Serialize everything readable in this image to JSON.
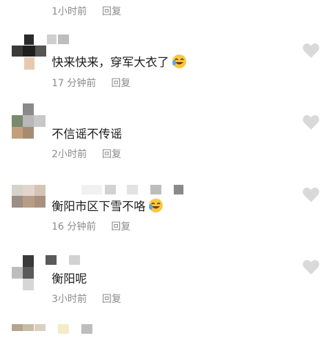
{
  "comments": [
    {
      "text": "",
      "time": "1小时前",
      "reply": "回复",
      "emoji": false
    },
    {
      "text": "快来快来，穿军大衣了",
      "time": "17 分钟前",
      "reply": "回复",
      "emoji": true
    },
    {
      "text": "不信谣不传谣",
      "time": "2小时前",
      "reply": "回复",
      "emoji": false
    },
    {
      "text": "衡阳市区下雪不咯",
      "time": "16 分钟前",
      "reply": "回复",
      "emoji": true
    },
    {
      "text": "衡阳呢",
      "time": "3小时前",
      "reply": "回复",
      "emoji": false
    }
  ],
  "colors": {
    "meta": "#8a8a8a",
    "text": "#1c1c1c",
    "heart": "#d9d9d9"
  },
  "icons": {
    "like": "heart-icon",
    "emoji": "laughing-tears-emoji"
  }
}
